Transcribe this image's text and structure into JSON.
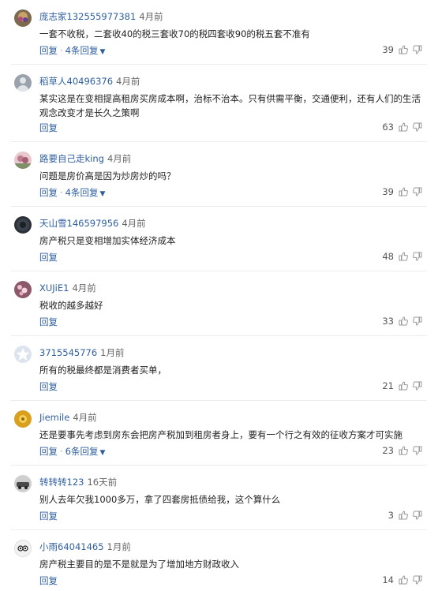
{
  "comments": [
    {
      "user": "庞志家132555977381",
      "time": "4月前",
      "text": "一套不收税，二套收40的税三套收70的税四套收90的税五套不准有",
      "reply": "回复",
      "more": "4条回复",
      "likes": "39",
      "avatar_color": "#7b6a4e"
    },
    {
      "user": "稻草人40496376",
      "time": "4月前",
      "text": "某实这是在变相提高租房买房成本啊，治标不治本。只有供需平衡，交通便利，还有人们的生活观念改变才是长久之策啊",
      "reply": "回复",
      "more": "",
      "likes": "63",
      "avatar_color": "#9aa3ad"
    },
    {
      "user": "路要自己走king",
      "time": "4月前",
      "text": "问题是房价高是因为炒房炒的吗？",
      "reply": "回复",
      "more": "4条回复",
      "likes": "39",
      "avatar_color": "#c79aa3"
    },
    {
      "user": "天山雪146597956",
      "time": "4月前",
      "text": "房产税只是变相增加实体经济成本",
      "reply": "回复",
      "more": "",
      "likes": "48",
      "avatar_color": "#2b2f36"
    },
    {
      "user": "XUJiE1",
      "time": "4月前",
      "text": "税收的越多越好",
      "reply": "回复",
      "more": "",
      "likes": "33",
      "avatar_color": "#8b5a6a"
    },
    {
      "user": "3715545776",
      "time": "1月前",
      "text": "所有的税最终都是消费者买单，",
      "reply": "回复",
      "more": "",
      "likes": "21",
      "avatar_color": "#dde4ee"
    },
    {
      "user": "Jiemile",
      "time": "4月前",
      "text": "还是要事先考虑到房东会把房产税加到租房者身上，要有一个行之有效的征收方案才可实施",
      "reply": "回复",
      "more": "6条回复",
      "likes": "23",
      "avatar_color": "#d9a020"
    },
    {
      "user": "转转转123",
      "time": "16天前",
      "text": "别人去年欠我1000多万，拿了四套房抵债给我，这个算什么",
      "reply": "回复",
      "more": "",
      "likes": "3",
      "avatar_color": "#5a5a5a"
    },
    {
      "user": "小雨64041465",
      "time": "1月前",
      "text": "房产税主要目的是不是就是为了增加地方财政收入",
      "reply": "回复",
      "more": "",
      "likes": "14",
      "avatar_color": "#f2f2f2"
    }
  ],
  "icons": {
    "like": "thumbs-up-icon",
    "dislike": "thumbs-down-icon",
    "expand": "chevron-down-icon"
  },
  "colors": {
    "link": "#2f5f9f",
    "text": "#222222",
    "divider": "#ececec"
  }
}
